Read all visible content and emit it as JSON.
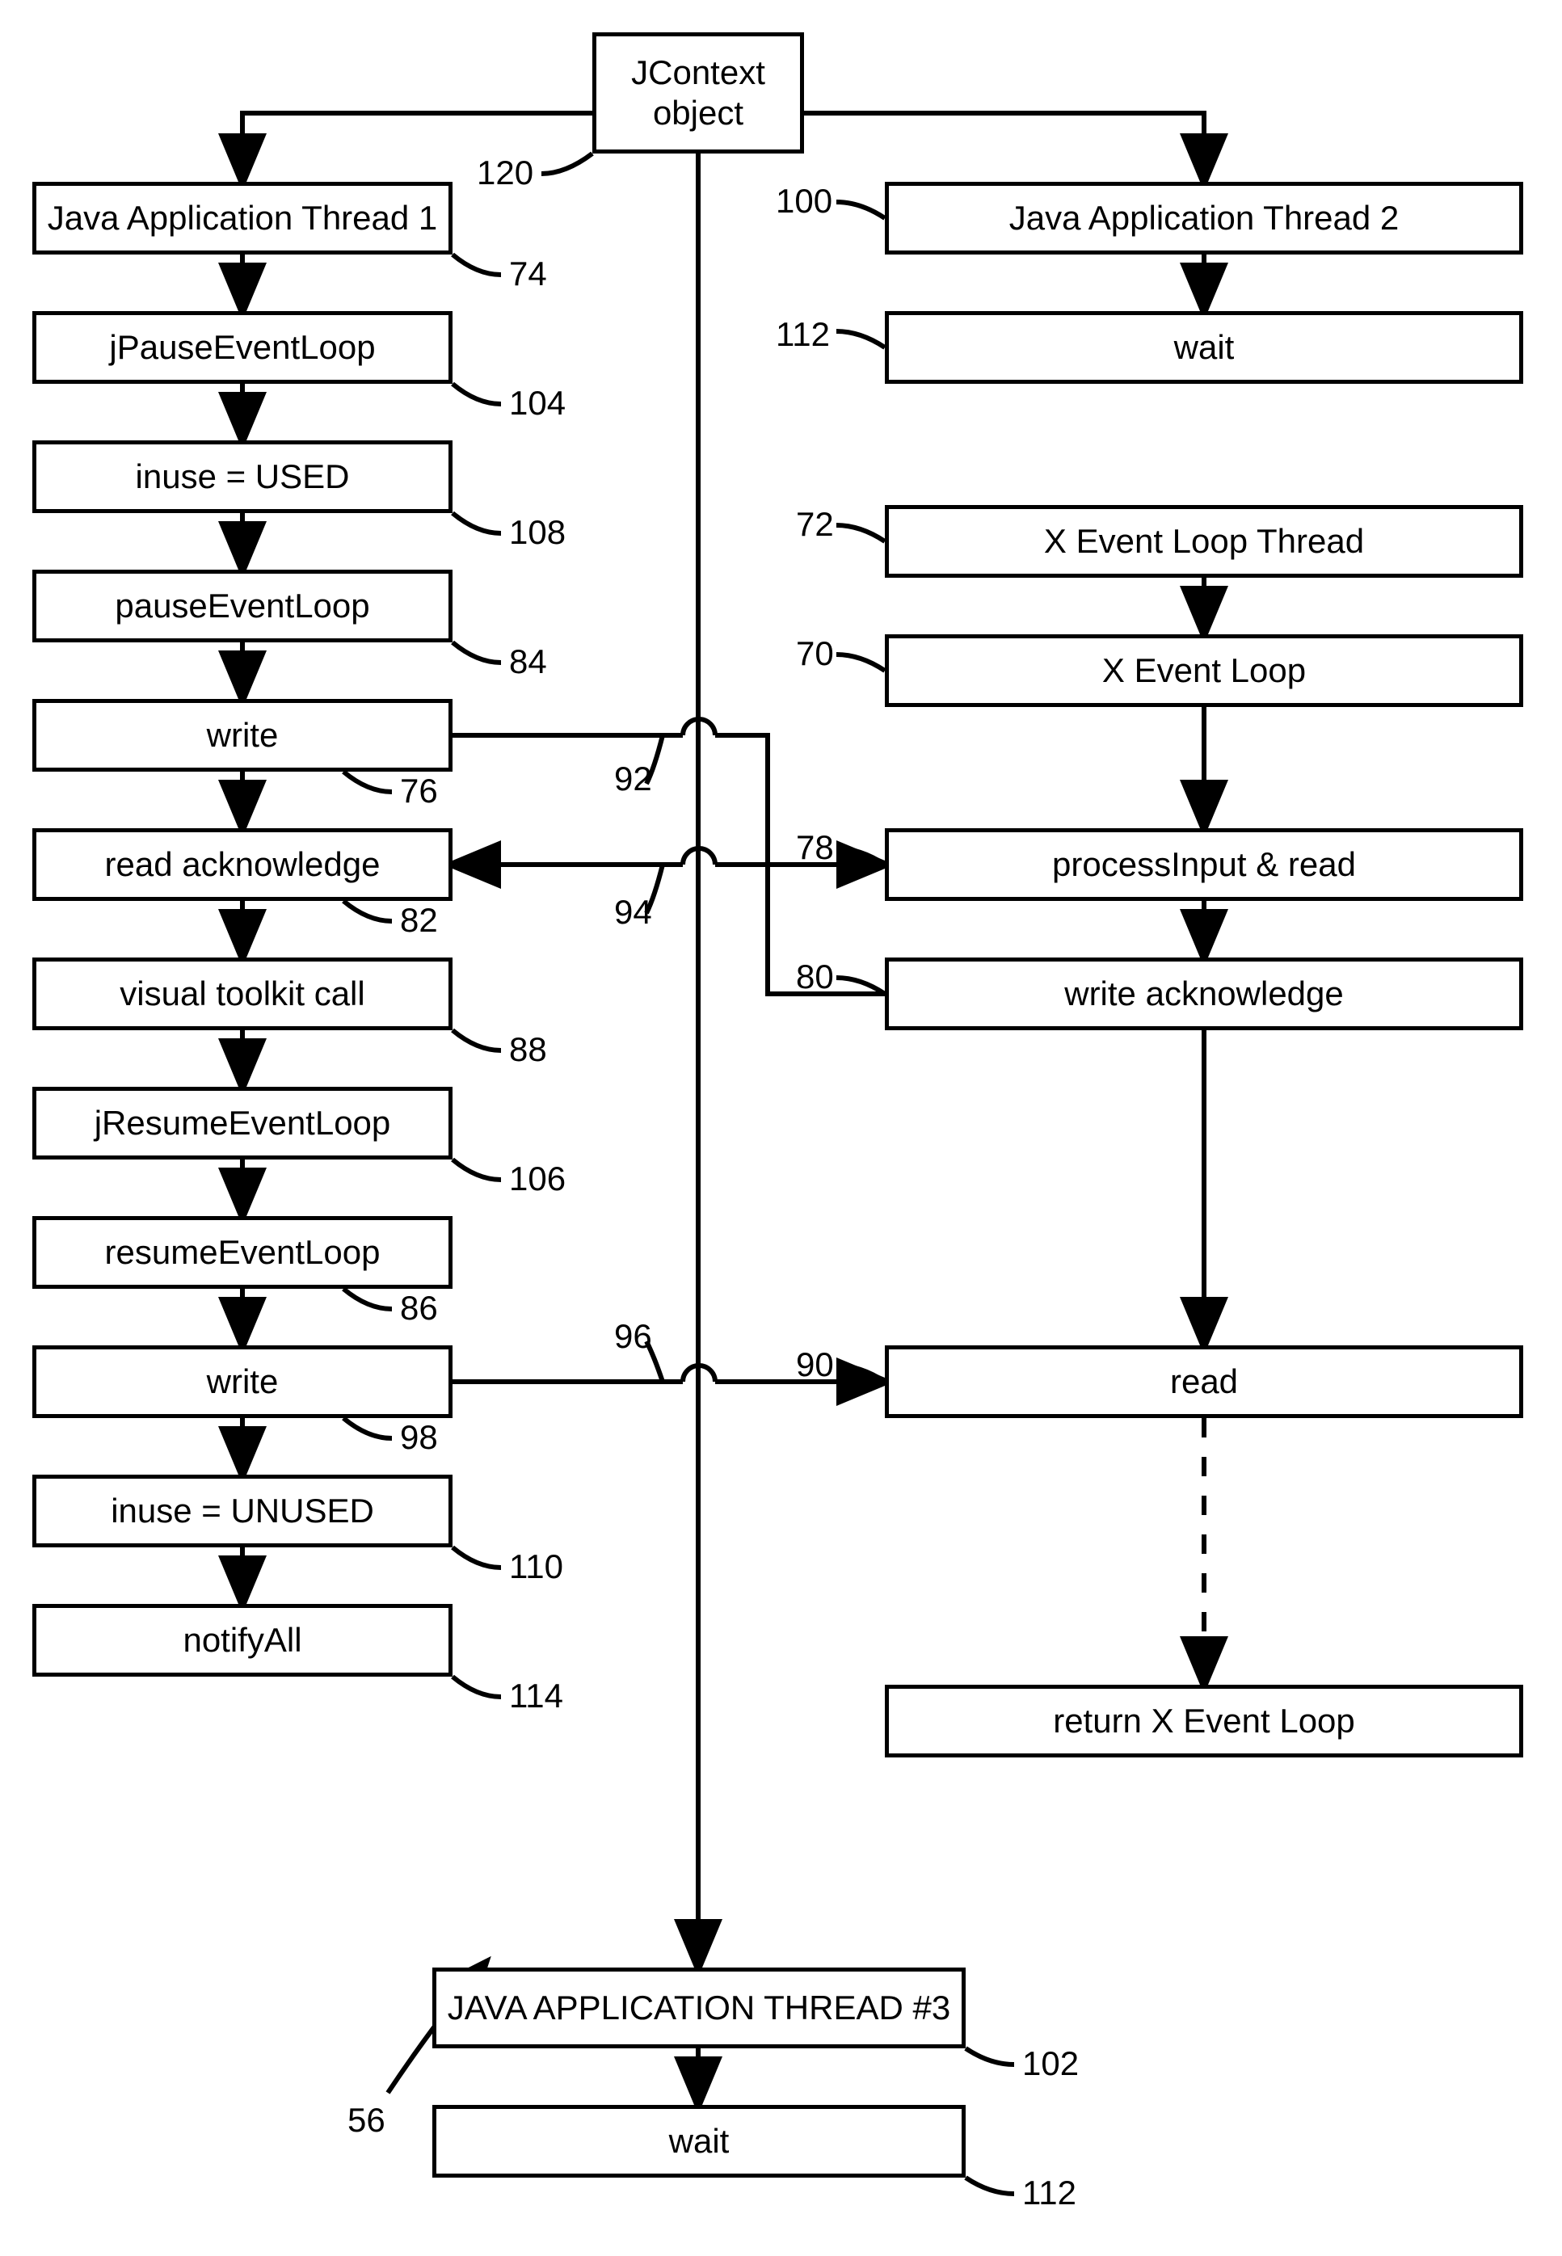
{
  "boxes": {
    "jcontext": "JContext\nobject",
    "jat1": "Java Application Thread 1",
    "jpause": "jPauseEventLoop",
    "inuse_used": "inuse = USED",
    "pauseEL": "pauseEventLoop",
    "write1": "write",
    "readack": "read  acknowledge",
    "visual": "visual toolkit call",
    "jresume": "jResumeEventLoop",
    "resumeEL": "resumeEventLoop",
    "write2": "write",
    "inuse_unused": "inuse = UNUSED",
    "notify": "notifyAll",
    "jat2": "Java Application Thread 2",
    "wait_r": "wait",
    "xthread": "X  Event Loop Thread",
    "xloop": "X  Event Loop",
    "procread": "processInput &  read",
    "writeack": "write acknowledge",
    "read_r": "read",
    "returnx": "return X  Event Loop",
    "jat3": "JAVA APPLICATION THREAD #3",
    "wait_b": "wait"
  },
  "refs": {
    "r120": "120",
    "r74": "74",
    "r104": "104",
    "r108": "108",
    "r84": "84",
    "r76": "76",
    "r92": "92",
    "r82": "82",
    "r94": "94",
    "r88": "88",
    "r106": "106",
    "r86": "86",
    "r96": "96",
    "r98": "98",
    "r110": "110",
    "r114": "114",
    "r100": "100",
    "r112a": "112",
    "r72": "72",
    "r70": "70",
    "r78": "78",
    "r80": "80",
    "r90": "90",
    "r102": "102",
    "r112b": "112",
    "r56": "56"
  }
}
